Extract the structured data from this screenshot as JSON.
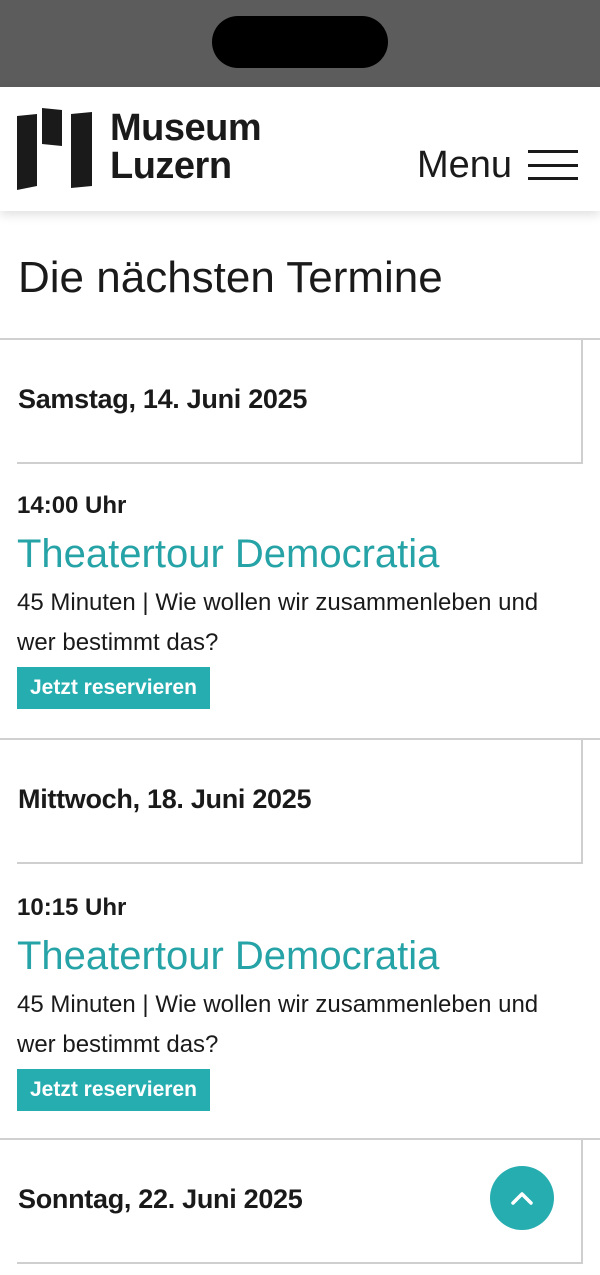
{
  "header": {
    "logo_line1": "Museum",
    "logo_line2": "Luzern",
    "menu_label": "Menu"
  },
  "page": {
    "title": "Die nächsten Termine"
  },
  "days": [
    {
      "date": "Samstag, 14. Juni 2025",
      "event": {
        "time": "14:00 Uhr",
        "title": "Theatertour Democratia",
        "description": "45 Minuten | Wie wollen wir zusammenleben und wer bestimmt das?",
        "button": "Jetzt reservieren"
      }
    },
    {
      "date": "Mittwoch, 18. Juni 2025",
      "event": {
        "time": "10:15 Uhr",
        "title": "Theatertour Democratia",
        "description": "45 Minuten | Wie wollen wir zusammenleben und wer bestimmt das?",
        "button": "Jetzt reservieren"
      }
    },
    {
      "date": "Sonntag, 22. Juni 2025"
    }
  ],
  "icons": {
    "menu": "hamburger-icon",
    "scroll_top": "chevron-up-icon"
  },
  "colors": {
    "accent": "#26adb0",
    "title_teal": "#26a3a6",
    "text": "#1a1a1a"
  }
}
